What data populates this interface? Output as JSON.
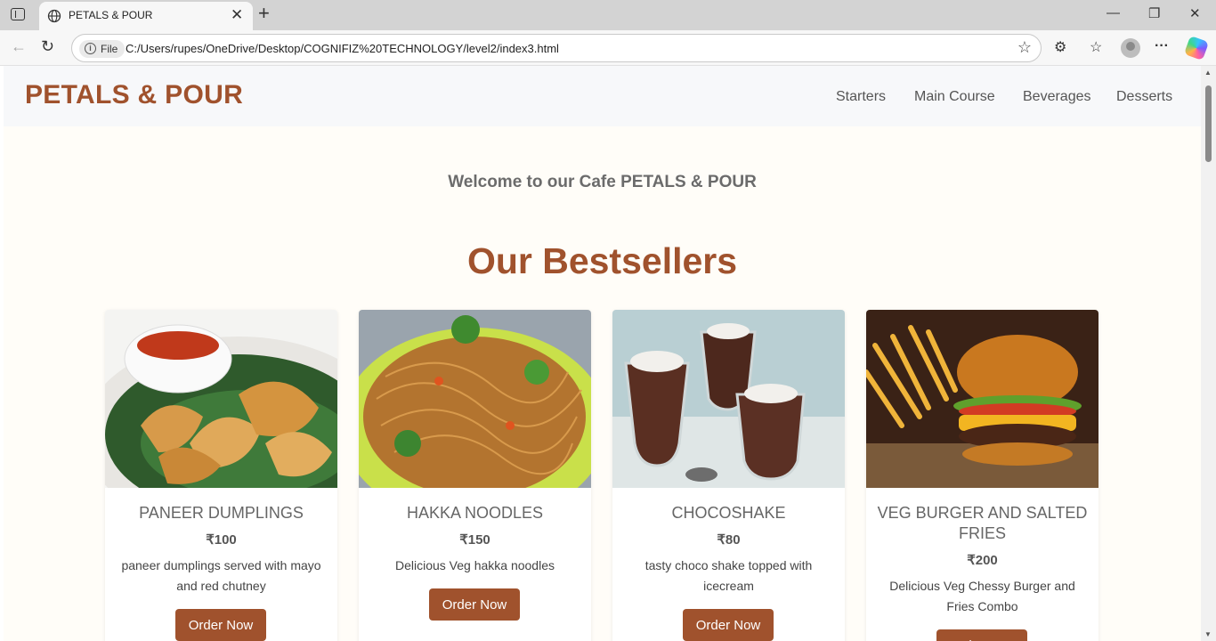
{
  "browser": {
    "tab_title": "PETALS & POUR",
    "file_label": "File",
    "url": "C:/Users/rupes/OneDrive/Desktop/COGNIFIZ%20TECHNOLOGY/level2/index3.html"
  },
  "site": {
    "brand": "PETALS & POUR",
    "nav": [
      "Starters",
      "Main Course",
      "Beverages",
      "Desserts"
    ],
    "welcome": "Welcome to our Cafe PETALS & POUR",
    "section_title": "Our Bestsellers"
  },
  "products": [
    {
      "name": "PANEER DUMPLINGS",
      "price": "₹100",
      "description": "paneer dumplings served with mayo and red chutney",
      "button": "Order Now",
      "image": "dumplings-photo"
    },
    {
      "name": "HAKKA NOODLES",
      "price": "₹150",
      "description": "Delicious Veg hakka noodles",
      "button": "Order Now",
      "image": "noodles-photo"
    },
    {
      "name": "CHOCOSHAKE",
      "price": "₹80",
      "description": "tasty choco shake topped with icecream",
      "button": "Order Now",
      "image": "chocoshake-photo"
    },
    {
      "name": "VEG BURGER AND SALTED FRIES",
      "price": "₹200",
      "description": "Delicious Veg Chessy Burger and Fries Combo",
      "button": "Order Now",
      "image": "burger-photo"
    }
  ],
  "colors": {
    "brand": "#a0522d",
    "header_bg": "#f7f8fa",
    "page_bg": "#fffdf8"
  }
}
